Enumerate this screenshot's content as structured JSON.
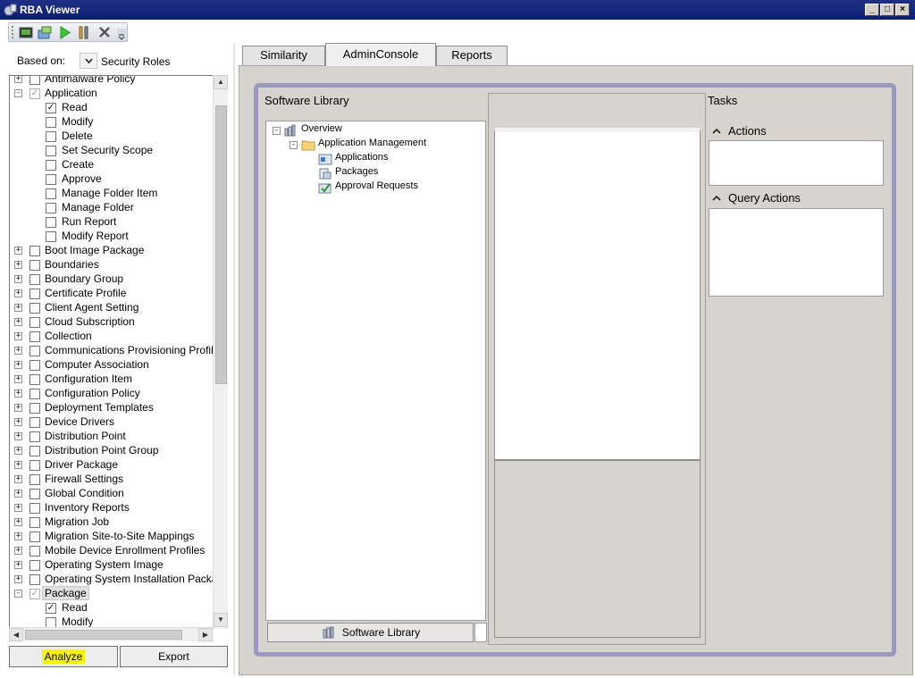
{
  "window": {
    "title": "RBA Viewer",
    "controls": [
      "_",
      "□",
      "×"
    ]
  },
  "toolbar": {
    "icons": [
      "console-icon",
      "import-icon",
      "run-icon",
      "settings-icon",
      "close-icon",
      "overflow-icon"
    ]
  },
  "left": {
    "based_on_label": "Based on:",
    "based_on_value": "Security Roles",
    "tree": [
      {
        "label": "Antimalware Policy",
        "level": 0,
        "expander": "+",
        "checked": false
      },
      {
        "label": "Application",
        "level": 0,
        "expander": "-",
        "checked": "partial"
      },
      {
        "label": "Read",
        "level": 1,
        "checked": true
      },
      {
        "label": "Modify",
        "level": 1,
        "checked": false
      },
      {
        "label": "Delete",
        "level": 1,
        "checked": false
      },
      {
        "label": "Set Security Scope",
        "level": 1,
        "checked": false
      },
      {
        "label": "Create",
        "level": 1,
        "checked": false
      },
      {
        "label": "Approve",
        "level": 1,
        "checked": false
      },
      {
        "label": "Manage Folder Item",
        "level": 1,
        "checked": false
      },
      {
        "label": "Manage Folder",
        "level": 1,
        "checked": false
      },
      {
        "label": "Run Report",
        "level": 1,
        "checked": false
      },
      {
        "label": "Modify Report",
        "level": 1,
        "checked": false
      },
      {
        "label": "Boot Image Package",
        "level": 0,
        "expander": "+",
        "checked": false
      },
      {
        "label": "Boundaries",
        "level": 0,
        "expander": "+",
        "checked": false
      },
      {
        "label": "Boundary Group",
        "level": 0,
        "expander": "+",
        "checked": false
      },
      {
        "label": "Certificate Profile",
        "level": 0,
        "expander": "+",
        "checked": false
      },
      {
        "label": "Client Agent Setting",
        "level": 0,
        "expander": "+",
        "checked": false
      },
      {
        "label": "Cloud Subscription",
        "level": 0,
        "expander": "+",
        "checked": false
      },
      {
        "label": "Collection",
        "level": 0,
        "expander": "+",
        "checked": false
      },
      {
        "label": "Communications Provisioning Profile",
        "level": 0,
        "expander": "+",
        "checked": false
      },
      {
        "label": "Computer Association",
        "level": 0,
        "expander": "+",
        "checked": false
      },
      {
        "label": "Configuration Item",
        "level": 0,
        "expander": "+",
        "checked": false
      },
      {
        "label": "Configuration Policy",
        "level": 0,
        "expander": "+",
        "checked": false
      },
      {
        "label": "Deployment Templates",
        "level": 0,
        "expander": "+",
        "checked": false
      },
      {
        "label": "Device Drivers",
        "level": 0,
        "expander": "+",
        "checked": false
      },
      {
        "label": "Distribution Point",
        "level": 0,
        "expander": "+",
        "checked": false
      },
      {
        "label": "Distribution Point Group",
        "level": 0,
        "expander": "+",
        "checked": false
      },
      {
        "label": "Driver Package",
        "level": 0,
        "expander": "+",
        "checked": false
      },
      {
        "label": "Firewall Settings",
        "level": 0,
        "expander": "+",
        "checked": false
      },
      {
        "label": "Global Condition",
        "level": 0,
        "expander": "+",
        "checked": false
      },
      {
        "label": "Inventory Reports",
        "level": 0,
        "expander": "+",
        "checked": false
      },
      {
        "label": "Migration Job",
        "level": 0,
        "expander": "+",
        "checked": false
      },
      {
        "label": "Migration Site-to-Site Mappings",
        "level": 0,
        "expander": "+",
        "checked": false
      },
      {
        "label": "Mobile Device Enrollment Profiles",
        "level": 0,
        "expander": "+",
        "checked": false
      },
      {
        "label": "Operating System Image",
        "level": 0,
        "expander": "+",
        "checked": false
      },
      {
        "label": "Operating System Installation Package",
        "level": 0,
        "expander": "+",
        "checked": false
      },
      {
        "label": "Package",
        "level": 0,
        "expander": "-",
        "checked": "partial",
        "selected": true
      },
      {
        "label": "Read",
        "level": 1,
        "checked": true
      },
      {
        "label": "Modify",
        "level": 1,
        "checked": false
      }
    ],
    "analyze_label": "Analyze",
    "export_label": "Export"
  },
  "tabs": [
    {
      "label": "Similarity",
      "active": false
    },
    {
      "label": "AdminConsole",
      "active": true
    },
    {
      "label": "Reports",
      "active": false
    }
  ],
  "console": {
    "section_title": "Software Library",
    "nav_tree": [
      {
        "label": "Overview",
        "level": 0,
        "expander": "-",
        "icon": "overview-icon"
      },
      {
        "label": "Application Management",
        "level": 1,
        "expander": "-",
        "icon": "folder-icon"
      },
      {
        "label": "Applications",
        "level": 2,
        "icon": "applications-icon"
      },
      {
        "label": "Packages",
        "level": 2,
        "icon": "packages-icon"
      },
      {
        "label": "Approval Requests",
        "level": 2,
        "icon": "approval-requests-icon"
      }
    ],
    "wunderbar_label": "Software Library",
    "tasks_title": "Tasks",
    "actions_label": "Actions",
    "query_actions_label": "Query Actions"
  },
  "colors": {
    "title_bar": "#0b1f70",
    "console_border": "#9b99be",
    "panel_bg": "#d7d4cf",
    "highlight": "#f7f500"
  }
}
